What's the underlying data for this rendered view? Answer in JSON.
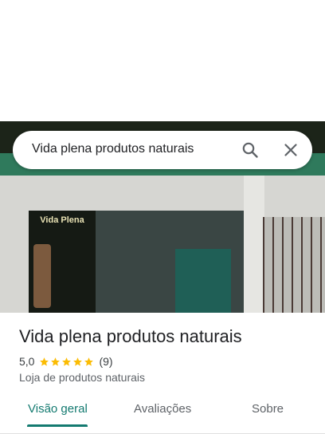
{
  "search": {
    "query": "Vida plena produtos naturais"
  },
  "photo": {
    "sign_title": "Vida Plena"
  },
  "place": {
    "name": "Vida plena produtos naturais",
    "rating": "5,0",
    "stars": 5,
    "review_count": "(9)",
    "category": "Loja de produtos naturais"
  },
  "tabs": [
    {
      "label": "Visão geral",
      "selected": true
    },
    {
      "label": "Avaliações",
      "selected": false
    },
    {
      "label": "Sobre",
      "selected": false
    }
  ],
  "colors": {
    "accent": "#137a70",
    "star": "#fbbc04"
  }
}
